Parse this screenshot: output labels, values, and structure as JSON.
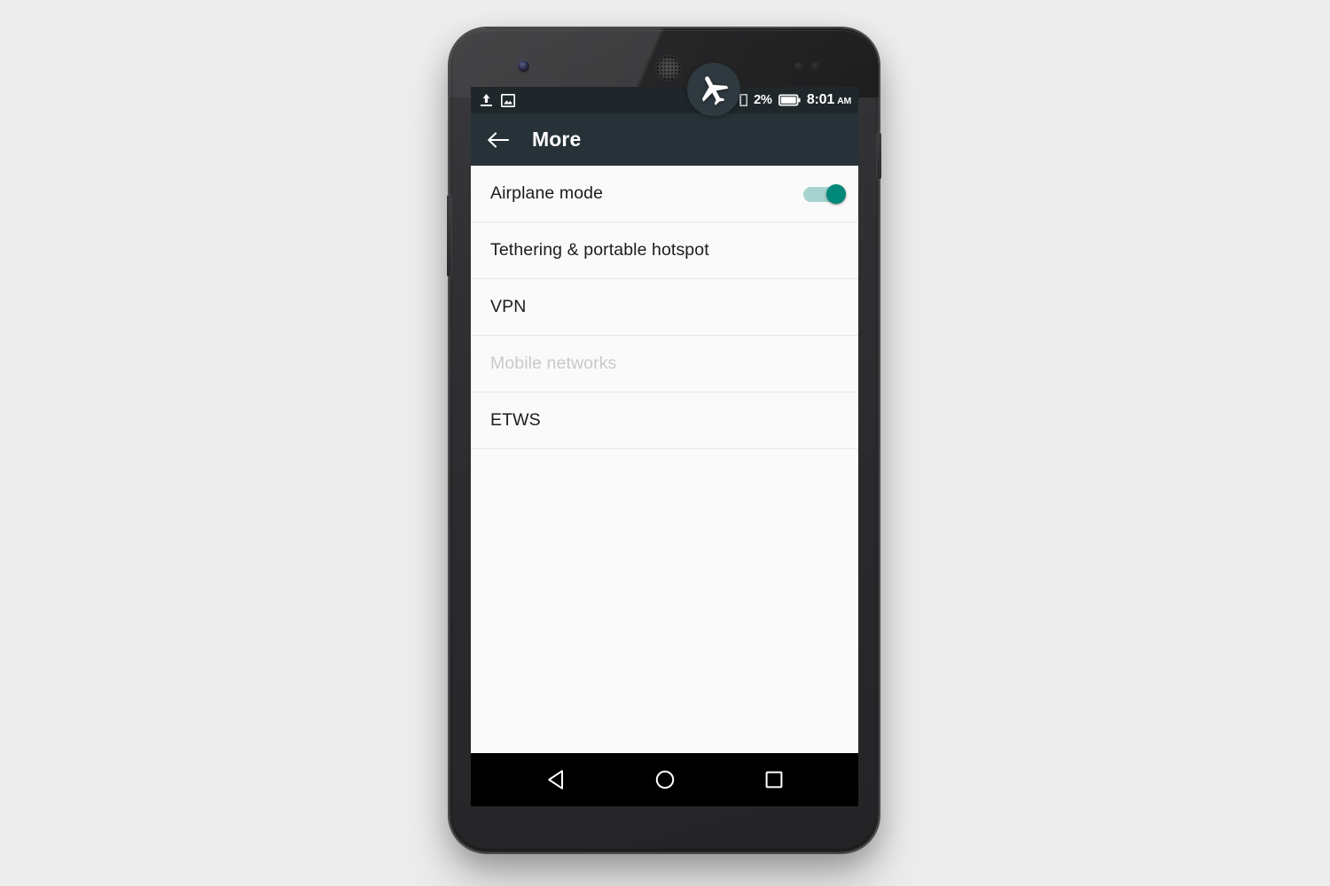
{
  "device": {
    "hardware": {
      "front_camera": "front-camera",
      "earpiece": "earpiece-speaker",
      "sensors": "proximity-sensors",
      "power_button": "power-button",
      "volume_button": "volume-rocker"
    }
  },
  "status_bar": {
    "left_icons": [
      "upload-icon",
      "screenshot-image-icon"
    ],
    "sim_icon": "sim-card-icon",
    "battery_percent": "2%",
    "battery_icon": "battery-icon",
    "time": "8:01",
    "meridiem": "AM"
  },
  "toolbar": {
    "back_icon": "back-arrow-icon",
    "title": "More"
  },
  "settings": {
    "rows": [
      {
        "label": "Airplane mode",
        "type": "toggle",
        "enabled": true,
        "disabled": false
      },
      {
        "label": "Tethering & portable hotspot",
        "type": "link",
        "disabled": false
      },
      {
        "label": "VPN",
        "type": "link",
        "disabled": false
      },
      {
        "label": "Mobile networks",
        "type": "link",
        "disabled": true
      },
      {
        "label": "ETWS",
        "type": "link",
        "disabled": false
      }
    ]
  },
  "nav_bar": {
    "back": "back-triangle-icon",
    "home": "home-circle-icon",
    "recents": "recents-square-icon"
  },
  "overlay": {
    "badge_icon": "airplane-icon"
  },
  "colors": {
    "page_background": "#ededed",
    "status_bar": "#1f272b",
    "toolbar": "#263238",
    "screen_background": "#fafafa",
    "toggle_accent": "#00897b",
    "toggle_track": "#a7d3cf",
    "nav_bar": "#000000",
    "disabled_text": "#c9c9c9"
  }
}
